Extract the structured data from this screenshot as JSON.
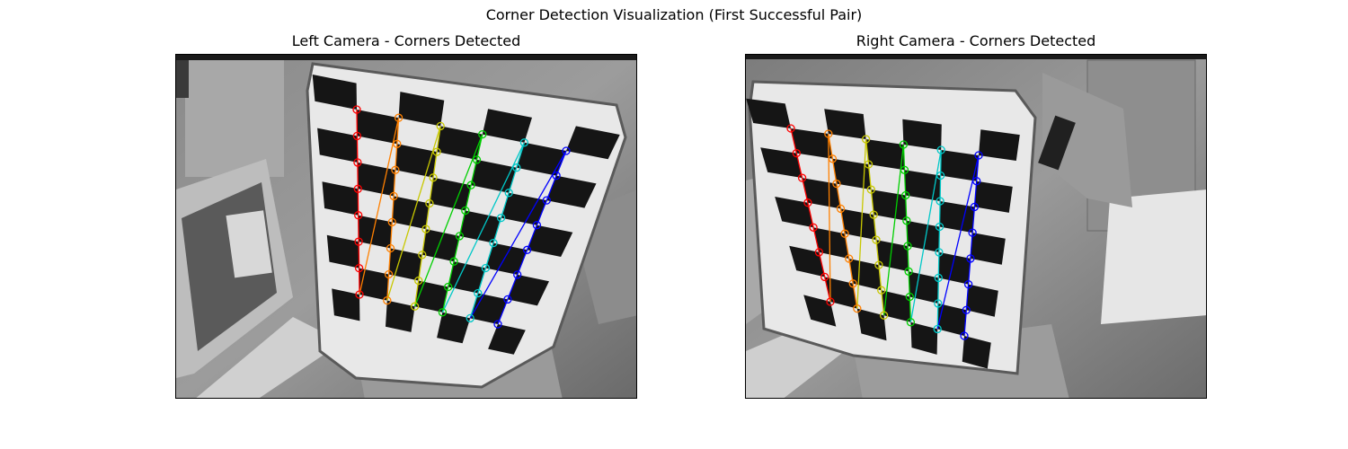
{
  "figure": {
    "title": "Corner Detection Visualization (First Successful Pair)"
  },
  "panels": [
    {
      "id": "left",
      "title": "Left Camera - Corners Detected"
    },
    {
      "id": "right",
      "title": "Right Camera - Corners Detected"
    }
  ],
  "colors": {
    "corner_columns": [
      "#ff0000",
      "#ff8000",
      "#c8c800",
      "#00d000",
      "#00c8c8",
      "#0000ff"
    ],
    "board_dark": "#151515",
    "board_light": "#e4e4e4"
  }
}
